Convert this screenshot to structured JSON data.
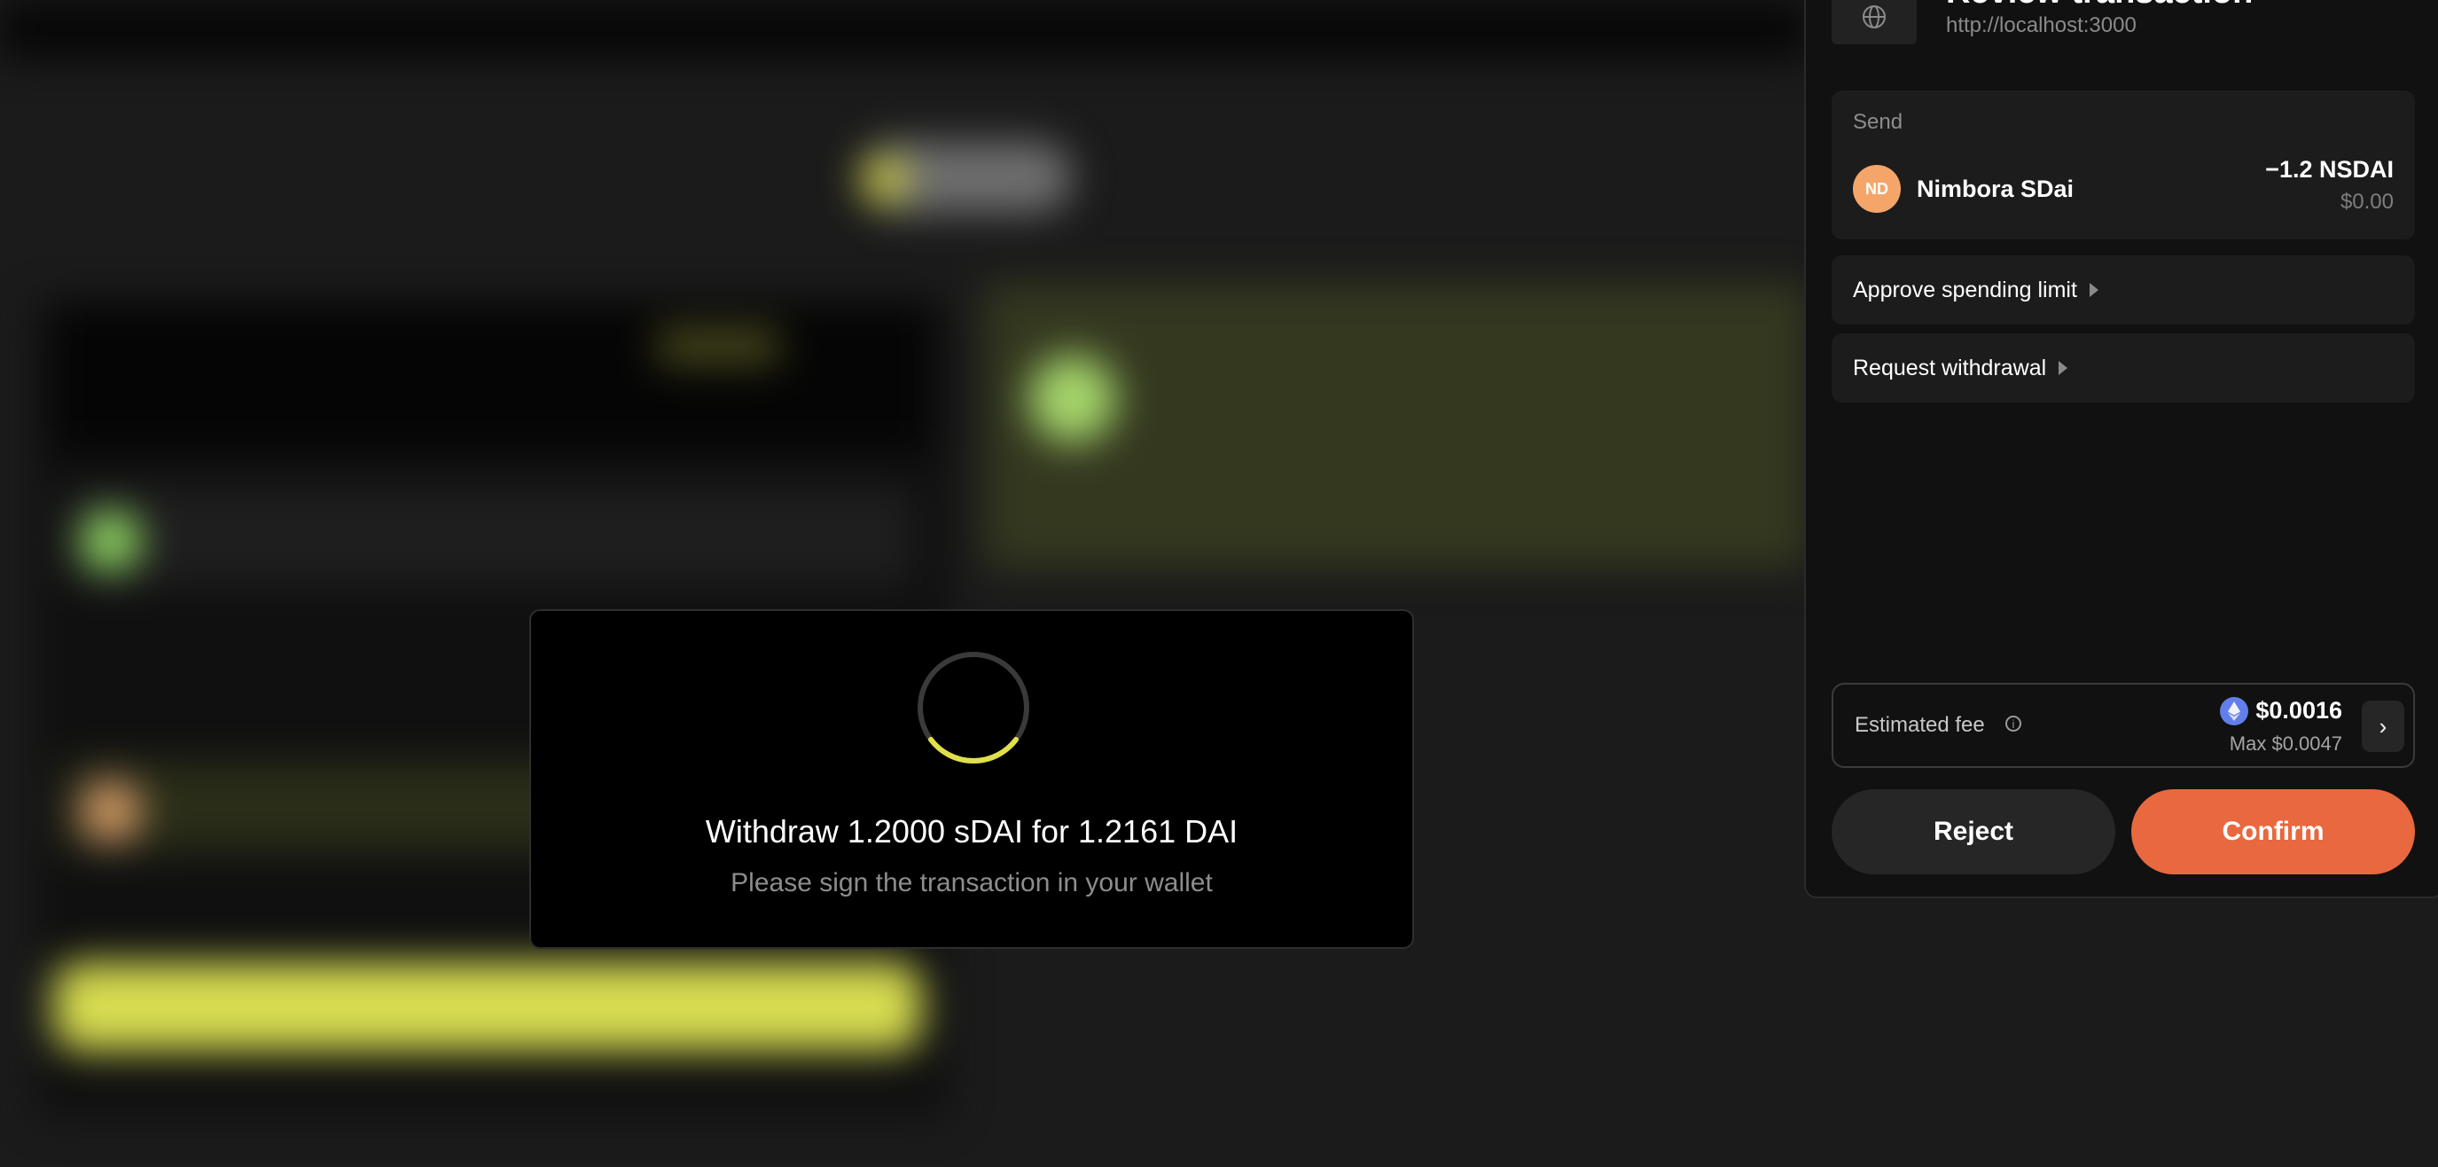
{
  "modal": {
    "title": "Withdraw 1.2000 sDAI for 1.2161 DAI",
    "subtitle": "Please sign the transaction in your wallet"
  },
  "wallet": {
    "title": "Review transaction",
    "origin": "http://localhost:3000",
    "send": {
      "label": "Send",
      "token_initials": "ND",
      "token_name": "Nimbora SDai",
      "amount": "−1.2 NSDAI",
      "usd": "$0.00",
      "token_color": "#f4a66a"
    },
    "calls": [
      {
        "label": "Approve spending limit"
      },
      {
        "label": "Request withdrawal"
      }
    ],
    "fee": {
      "label": "Estimated fee",
      "value": "$0.0016",
      "max": "Max $0.0047",
      "icon": "eth-icon"
    },
    "buttons": {
      "reject": "Reject",
      "confirm": "Confirm"
    },
    "colors": {
      "confirm": "#e8683f",
      "accent_spinner": "#e0e04a"
    }
  }
}
